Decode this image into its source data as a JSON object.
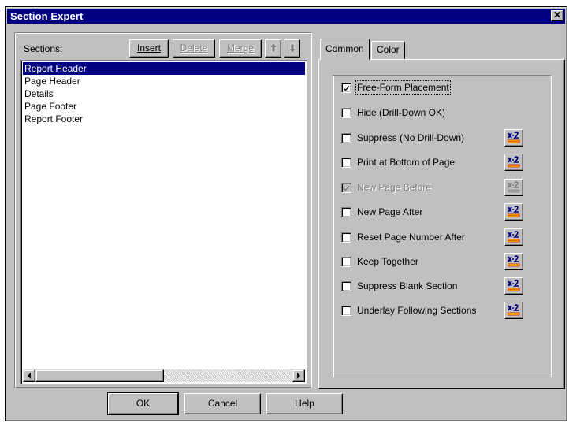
{
  "window": {
    "title": "Section Expert",
    "close_label": "✕"
  },
  "sections": {
    "label": "Sections:",
    "toolbar": {
      "insert": "Insert",
      "delete": "Delete",
      "merge": "Merge",
      "move_up_icon": "arrow-up-icon",
      "move_down_icon": "arrow-down-icon"
    },
    "items": [
      "Report Header",
      "Page Header",
      "Details",
      "Page Footer",
      "Report Footer"
    ],
    "selected_index": 0
  },
  "tabs": [
    {
      "label": "Common",
      "active": true
    },
    {
      "label": "Color",
      "active": false
    }
  ],
  "options": [
    {
      "label": "Free-Form Placement",
      "checked": true,
      "enabled": true,
      "formula_button": false
    },
    {
      "label": "Hide (Drill-Down OK)",
      "checked": false,
      "enabled": true,
      "formula_button": false
    },
    {
      "label": "Suppress (No Drill-Down)",
      "checked": false,
      "enabled": true,
      "formula_button": true
    },
    {
      "label": "Print at Bottom of Page",
      "checked": false,
      "enabled": true,
      "formula_button": true
    },
    {
      "label": "New Page Before",
      "checked": true,
      "enabled": false,
      "formula_button": true
    },
    {
      "label": "New Page After",
      "checked": false,
      "enabled": true,
      "formula_button": true
    },
    {
      "label": "Reset Page Number After",
      "checked": false,
      "enabled": true,
      "formula_button": true
    },
    {
      "label": "Keep Together",
      "checked": false,
      "enabled": true,
      "formula_button": true
    },
    {
      "label": "Suppress Blank Section",
      "checked": false,
      "enabled": true,
      "formula_button": true
    },
    {
      "label": "Underlay Following Sections",
      "checked": false,
      "enabled": true,
      "formula_button": true
    }
  ],
  "buttons": {
    "ok": "OK",
    "cancel": "Cancel",
    "help": "Help"
  },
  "colors": {
    "title_bar": "#000080",
    "face": "#c0c0c0",
    "selection": "#000080",
    "formula_icon_blue": "#000080",
    "formula_icon_red": "#cc0000",
    "formula_icon_yellow": "#ffff00"
  }
}
